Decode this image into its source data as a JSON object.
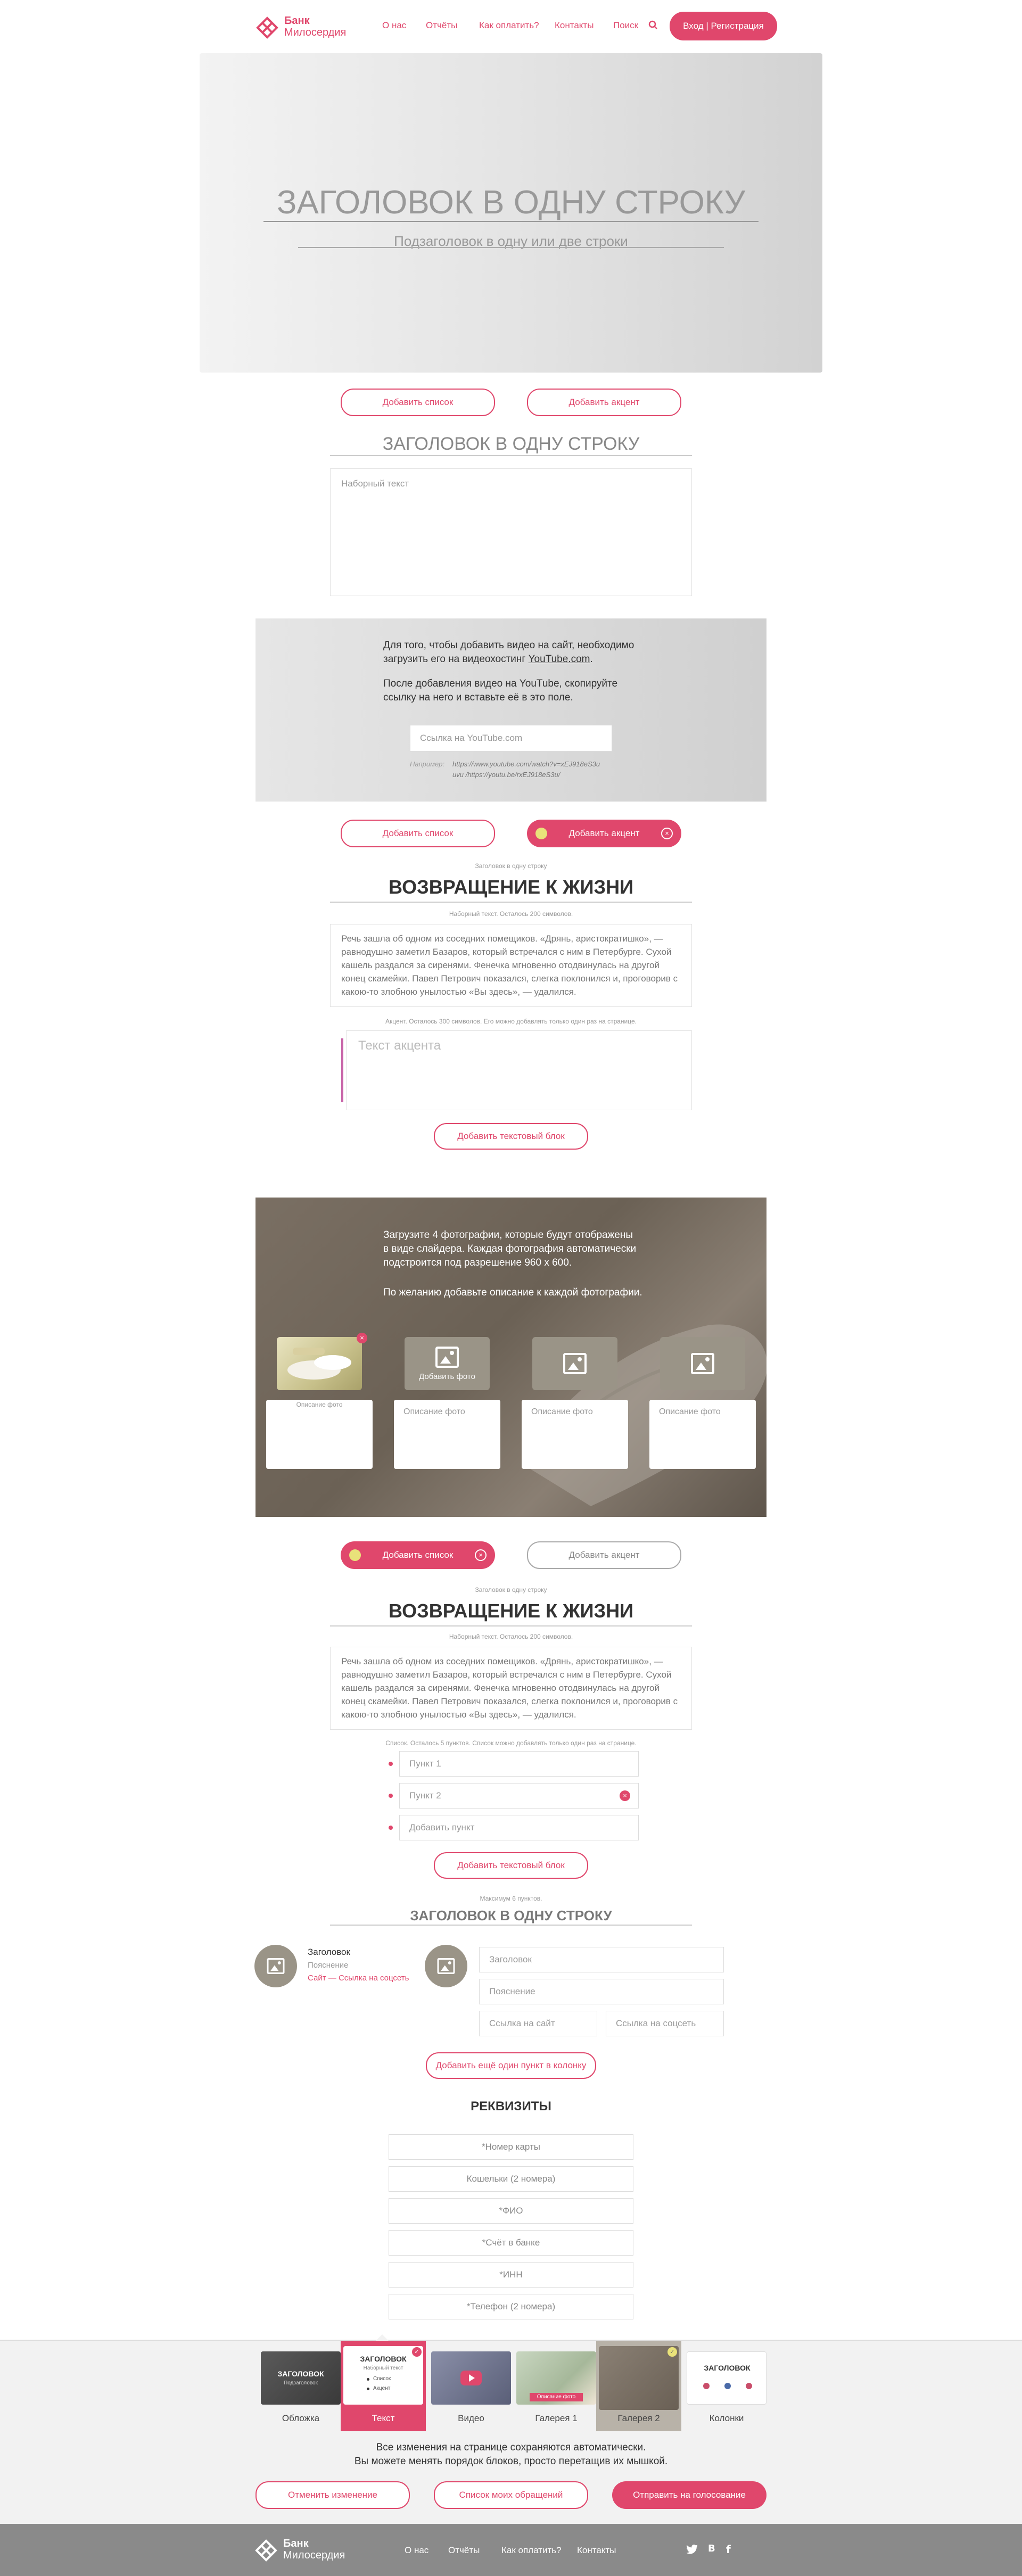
{
  "header": {
    "logo_line1": "Банк",
    "logo_line2": "Милосердия",
    "nav": [
      "О нас",
      "Отчёты",
      "Как оплатить?",
      "Контакты",
      "Поиск"
    ],
    "login_label": "Вход | Регистрация"
  },
  "hero": {
    "title": "ЗАГОЛОВОК В ОДНУ СТРОКУ",
    "subtitle": "Подзаголовок в одну или две строки"
  },
  "block1": {
    "add_list": "Добавить список",
    "add_accent": "Добавить акцент",
    "title": "ЗАГОЛОВОК В ОДНУ СТРОКУ",
    "text_placeholder": "Наборный текст"
  },
  "video": {
    "line1": "Для того, чтобы добавить видео на сайт, необходимо",
    "line2_pre": "загрузить его на видеохостинг ",
    "line2_link": "YouTube.com",
    "line2_post": ".",
    "line3": "После добавления видео на YouTube, скопируйте",
    "line4": "ссылку на него и вставьте её в это поле.",
    "input_placeholder": "Ссылка на YouTube.com",
    "example_label": "Например:",
    "example1": "https://www.youtube.com/watch?v=xEJ918eS3u",
    "example2": "uvu /https://youtu.be/rxEJ918eS3u/"
  },
  "block2": {
    "add_list": "Добавить список",
    "add_accent": "Добавить акцент",
    "hint_title": "Заголовок в одну строку",
    "title": "ВОЗВРАЩЕНИЕ К ЖИЗНИ",
    "hint_text": "Наборный текст. Осталось 200 символов.",
    "paragraph": "Речь зашла об одном из соседних помещиков. «Дрянь, аристократишко», — равнодушно заметил Базаров, который встречался с ним в Петербурге. Сухой кашель раздался за сиренями. Фенечка мгновенно отодвинулась на другой конец скамейки. Павел Петрович показался, слегка поклонился и, проговорив с какою-то злобною унылостью «Вы здесь», — удалился.",
    "hint_accent": "Акцент. Осталось 300 символов. Его можно добавлять только один раз на странице.",
    "accent_placeholder": "Текст акцента",
    "add_text_block": "Добавить текстовый блок"
  },
  "gallery": {
    "line1": "Загрузите 4 фотографии, которые будут отображены",
    "line2": "в виде слайдера. Каждая фотография автоматически",
    "line3": "подстроится под разрешение 960 х 600.",
    "line4": "По желанию добавьте описание к каждой фотографии.",
    "add_photo": "Добавить фото",
    "first_desc": "Описание фото",
    "desc_placeholder": "Описание фото"
  },
  "block3": {
    "add_list": "Добавить список",
    "add_accent": "Добавить акцент",
    "hint_title": "Заголовок в одну строку",
    "title": "ВОЗВРАЩЕНИЕ К ЖИЗНИ",
    "hint_text": "Наборный текст. Осталось 200 символов.",
    "paragraph": "Речь зашла об одном из соседних помещиков. «Дрянь, аристократишко», — равнодушно заметил Базаров, который встречался с ним в Петербурге. Сухой кашель раздался за сиренями. Фенечка мгновенно отодвинулась на другой конец скамейки. Павел Петрович показался, слегка поклонился и, проговорив с какою-то злобною унылостью «Вы здесь», — удалился.",
    "hint_list": "Список. Осталось 5 пунктов. Список можно добавлять только один раз на странице.",
    "items": [
      "Пункт 1",
      "Пункт 2",
      "Добавить пункт"
    ],
    "add_text_block": "Добавить текстовый блок"
  },
  "columns": {
    "hint": "Максимум 6 пунктов.",
    "title": "ЗАГОЛОВОК В ОДНУ СТРОКУ",
    "card_title": "Заголовок",
    "card_sub": "Пояснение",
    "card_link_site": "Сайт",
    "card_link_sep": "—",
    "card_link_social": "Ссылка на соцсеть",
    "f_title": "Заголовок",
    "f_sub": "Пояснение",
    "f_site": "Ссылка на сайт",
    "f_social": "Ссылка на соцсеть",
    "add_more": "Добавить ещё один пункт в колонку"
  },
  "requisites": {
    "title": "РЕКВИЗИТЫ",
    "fields": [
      "*Номер карты",
      "Кошельки (2 номера)",
      "*ФИО",
      "*Счёт в банке",
      "*ИНН",
      "*Телефон (2 номера)"
    ]
  },
  "tray": {
    "items": [
      {
        "label": "Обложка",
        "thumb_title": "ЗАГОЛОВОК",
        "thumb_sub": "Подзаголовок"
      },
      {
        "label": "Текст",
        "thumb_title": "ЗАГОЛОВОК",
        "thumb_sub": "Наборный текст",
        "thumb_l1": "Список",
        "thumb_l2": "Акцент"
      },
      {
        "label": "Видео"
      },
      {
        "label": "Галерея 1",
        "thumb_sub": "Описание фото"
      },
      {
        "label": "Галерея 2"
      },
      {
        "label": "Колонки",
        "thumb_title": "ЗАГОЛОВОК"
      }
    ],
    "note1": "Все изменения на странице сохраняются автоматически.",
    "note2": "Вы можете менять порядок блоков, просто перетащив их мышкой.",
    "cancel": "Отменить изменение",
    "my_list": "Список моих обращений",
    "submit": "Отправить на голосование"
  },
  "footer": {
    "logo_line1": "Банк",
    "logo_line2": "Милосердия",
    "nav": [
      "О нас",
      "Отчёты",
      "Как оплатить?",
      "Контакты"
    ],
    "social": [
      "twitter-icon",
      "vk-icon",
      "facebook-icon"
    ]
  },
  "colors": {
    "accent": "#e0476c",
    "tray_bg": "#f2f2f2",
    "footer_bg": "#8a8a8a"
  }
}
